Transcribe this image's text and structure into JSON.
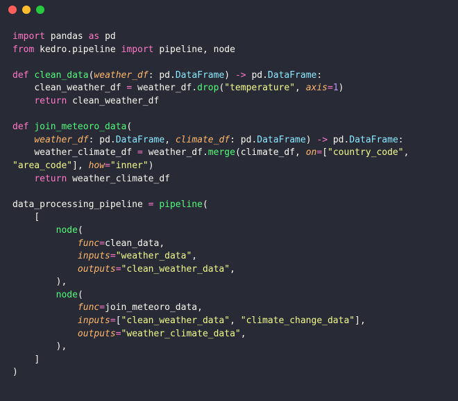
{
  "titlebar": {
    "close": "close-window",
    "min": "minimize-window",
    "max": "maximize-window"
  },
  "code": {
    "kw_import": "import",
    "kw_from": "from",
    "kw_as": "as",
    "kw_def": "def",
    "kw_return": "return",
    "mod_pandas": "pandas",
    "alias_pd": "pd",
    "mod_kedro_pipeline": "kedro.pipeline",
    "imp_pipeline": "pipeline",
    "imp_node": "node",
    "fn_clean_data": "clean_data",
    "fn_join_meteoro_data": "join_meteoro_data",
    "prm_weather_df": "weather_df",
    "prm_climate_df": "climate_df",
    "type_pd": "pd",
    "type_DataFrame": "DataFrame",
    "var_clean_weather_df": "clean_weather_df",
    "var_weather_df": "weather_df",
    "var_climate_df": "climate_df",
    "var_weather_climate_df": "weather_climate_df",
    "var_data_processing_pipeline": "data_processing_pipeline",
    "call_pipeline": "pipeline",
    "call_node": "node",
    "method_drop": "drop",
    "method_merge": "merge",
    "kw_axis": "axis",
    "kw_on": "on",
    "kw_how": "how",
    "kw_func": "func",
    "kw_inputs": "inputs",
    "kw_outputs": "outputs",
    "str_temperature": "\"temperature\"",
    "str_country_code": "\"country_code\"",
    "str_area_code": "\"area_code\"",
    "str_inner": "\"inner\"",
    "str_weather_data": "\"weather_data\"",
    "str_clean_weather_data": "\"clean_weather_data\"",
    "str_climate_change_data": "\"climate_change_data\"",
    "str_weather_climate_data": "\"weather_climate_data\"",
    "num_1": "1",
    "p_open": "(",
    "p_close": ")",
    "b_open": "[",
    "b_close": "]",
    "comma": ",",
    "colon": ":",
    "dot": ".",
    "eq": "=",
    "arrow": "->"
  }
}
